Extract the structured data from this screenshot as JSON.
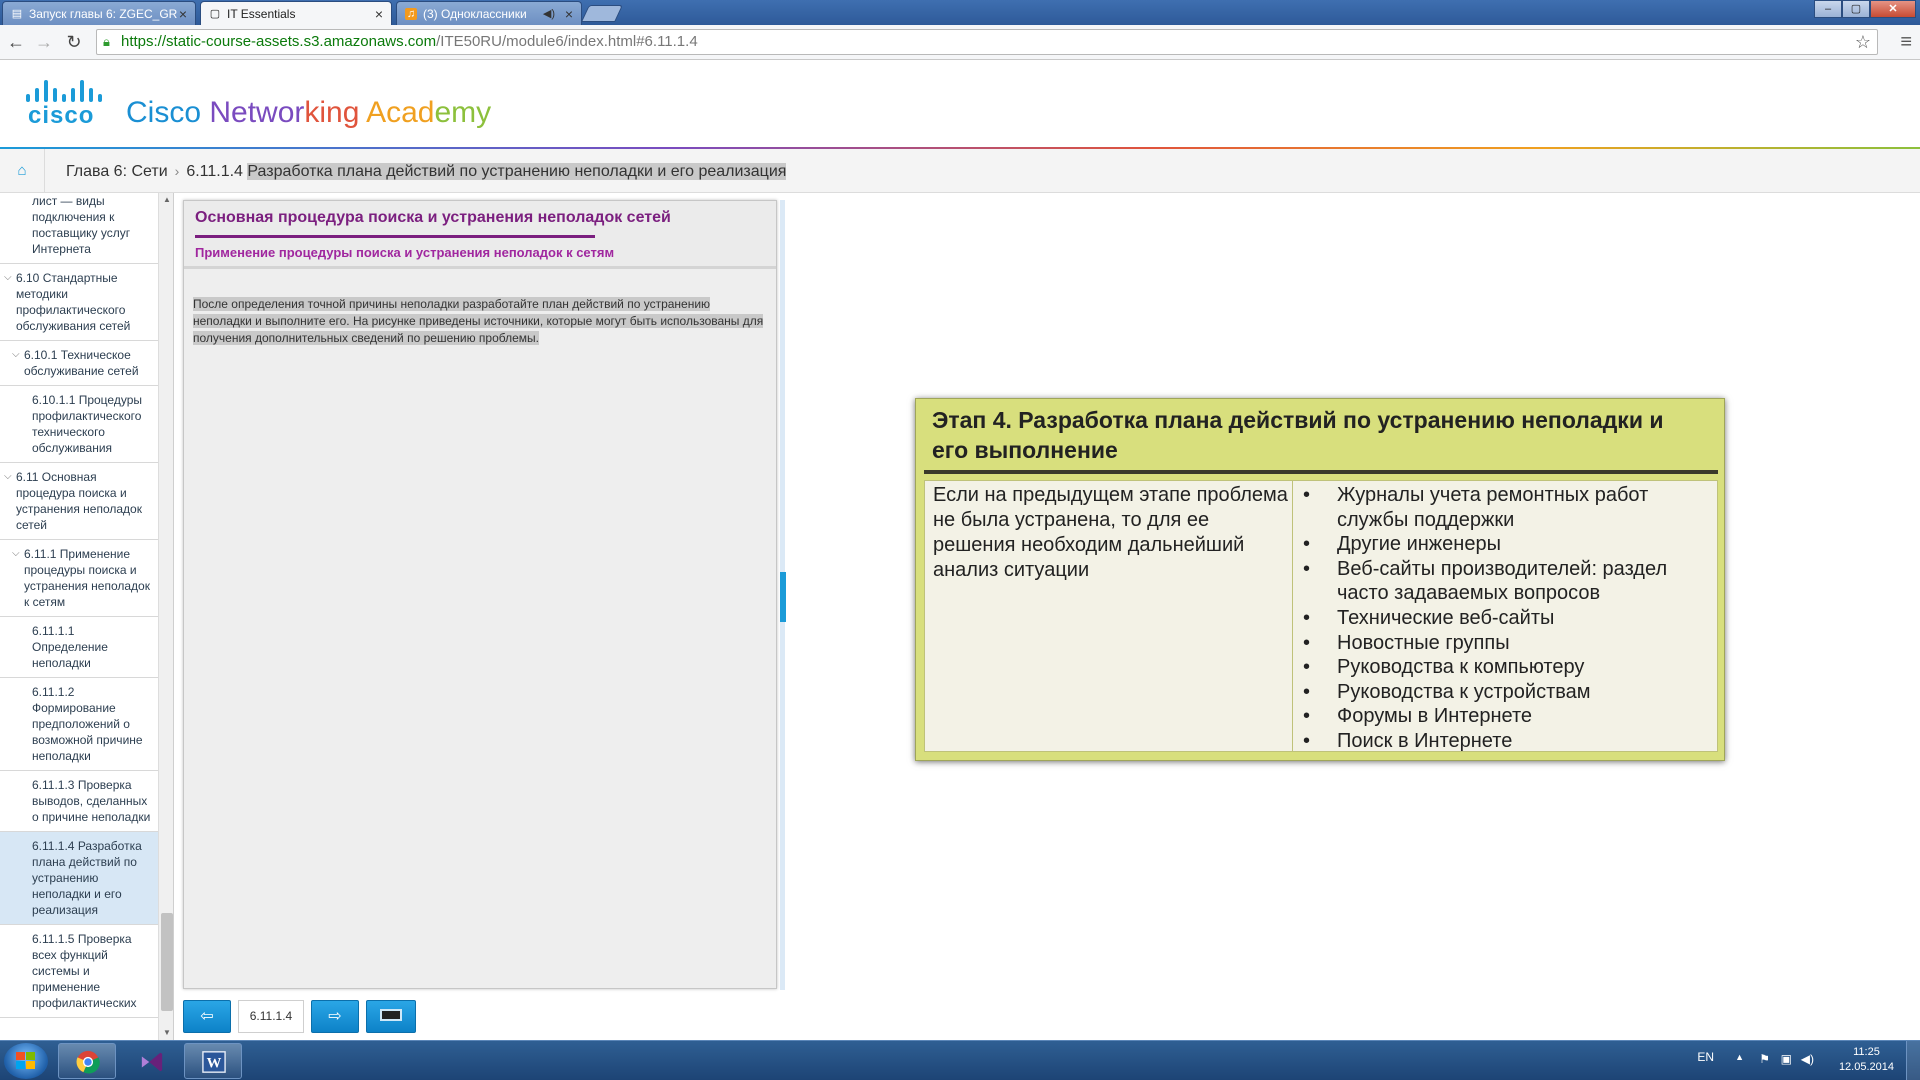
{
  "browser": {
    "tabs": [
      {
        "label": "Запуск главы 6: ZGEC_GR",
        "icon": "page-icon"
      },
      {
        "label": "IT Essentials",
        "icon": "page-icon"
      },
      {
        "label": "(3) Одноклассники",
        "icon": "music-icon"
      }
    ],
    "url_host": "https://static-course-assets.s3.amazonaws.com",
    "url_path": "/ITE50RU/module6/index.html#6.11.1.4"
  },
  "header": {
    "logo_word": "cisco",
    "brand_parts": [
      "Cisco ",
      "Networ",
      "king",
      " Acad",
      "emy"
    ],
    "accent_color": "#1b9bd8"
  },
  "breadcrumb": {
    "chapter": "Глава 6: Сети",
    "section_number": "6.11.1.4",
    "section_title": "Разработка плана действий по устранению неполадки и его реализация"
  },
  "leftnav": {
    "items": [
      {
        "text": "лист — виды подключения к поставщику услуг Интернета",
        "level": 2
      },
      {
        "text": "6.10 Стандартные методики профилактического обслуживания сетей",
        "level": 0
      },
      {
        "text": "6.10.1 Техническое обслуживание сетей",
        "level": 1
      },
      {
        "text": "6.10.1.1 Процедуры профилактического технического обслуживания",
        "level": 2
      },
      {
        "text": "6.11 Основная процедура поиска и устранения неполадок сетей",
        "level": 0
      },
      {
        "text": "6.11.1 Применение процедуры поиска и устранения неполадок к сетям",
        "level": 1
      },
      {
        "text": "6.11.1.1 Определение неполадки",
        "level": 2
      },
      {
        "text": "6.11.1.2 Формирование предположений о возможной причине неполадки",
        "level": 2
      },
      {
        "text": "6.11.1.3 Проверка выводов, сделанных о причине неполадки",
        "level": 2
      },
      {
        "text": "6.11.1.4 Разработка плана действий по устранению неполадки и его реализация",
        "level": 2,
        "active": true
      },
      {
        "text": "6.11.1.5 Проверка всех функций системы и применение профилактических",
        "level": 2
      }
    ]
  },
  "panel": {
    "title": "Основная процедура поиска и устранения неполадок сетей",
    "subtitle": "Применение процедуры поиска и устранения неполадок к сетям",
    "body": "После определения точной причины неполадки разработайте план действий по устранению неполадки и выполните его. На рисунке приведены источники, которые могут быть использованы для получения дополнительных сведений по решению проблемы.",
    "title_color": "#7b1f7f"
  },
  "footer": {
    "page_indicator": "6.11.1.4"
  },
  "figure": {
    "title": "Этап 4. Разработка плана действий по устранению неполадки и его выполнение",
    "left_text": "Если на предыдущем этапе проблема не была устранена, то для ее решения необходим дальнейший анализ ситуации",
    "sources": [
      "Журналы учета ремонтных работ службы поддержки",
      "Другие инженеры",
      "Веб-сайты производителей: раздел часто задаваемых вопросов",
      "Технические веб-сайты",
      "Новостные группы",
      "Руководства к компьютеру",
      "Руководства к устройствам",
      "Форумы в Интернете",
      "Поиск в Интернете"
    ],
    "bg_color": "#d8df7d"
  },
  "taskbar": {
    "lang": "EN",
    "time": "11:25",
    "date": "12.05.2014"
  }
}
